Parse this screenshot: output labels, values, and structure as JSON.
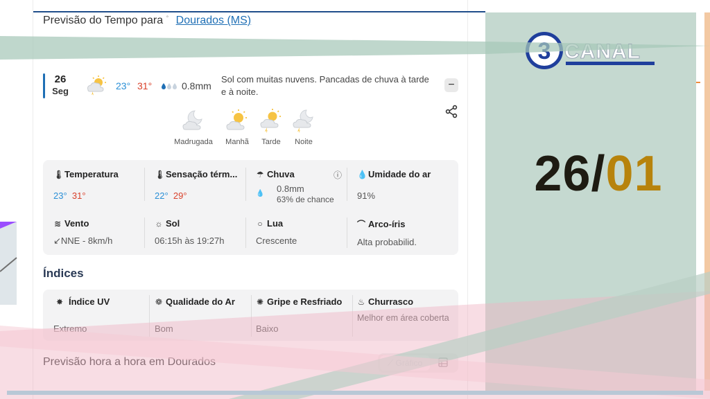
{
  "header": {
    "title": "Previsão do Tempo para",
    "superscript": "°",
    "city": "Dourados (MS)"
  },
  "day": {
    "number": "26",
    "weekday": "Seg",
    "temp_min": "23°",
    "temp_max": "31°",
    "rain": "0.8mm",
    "description": "Sol com muitas nuvens. Pancadas de chuva à tarde e à noite.",
    "collapse_label": "−",
    "icon": "partly-cloudy-rain-icon"
  },
  "periods": [
    {
      "label": "Madrugada",
      "icon": "moon-cloud-icon"
    },
    {
      "label": "Manhã",
      "icon": "sun-cloud-icon"
    },
    {
      "label": "Tarde",
      "icon": "sun-cloud-storm-icon"
    },
    {
      "label": "Noite",
      "icon": "moon-cloud-storm-icon"
    }
  ],
  "details": {
    "temperature": {
      "title": "Temperatura",
      "min": "23°",
      "max": "31°"
    },
    "feels_like": {
      "title": "Sensação térm...",
      "min": "22°",
      "max": "29°"
    },
    "rain": {
      "title": "Chuva",
      "amount": "0.8mm",
      "chance": "63% de chance"
    },
    "humidity": {
      "title": "Umidade do ar",
      "value": "91%"
    },
    "wind": {
      "title": "Vento",
      "value": "↙NNE - 8km/h"
    },
    "sun": {
      "title": "Sol",
      "value": "06:15h às 19:27h"
    },
    "moon": {
      "title": "Lua",
      "value": "Crescente"
    },
    "rainbow": {
      "title": "Arco-íris",
      "value": "Alta probabilid."
    }
  },
  "indices": {
    "title": "Índices",
    "items": [
      {
        "title": "Índice UV",
        "value": "Extremo"
      },
      {
        "title": "Qualidade do Ar",
        "value": "Bom"
      },
      {
        "title": "Gripe e Resfriado",
        "value": "Baixo"
      },
      {
        "title": "Churrasco",
        "value": "Melhor em área coberta"
      }
    ]
  },
  "hourly": {
    "title": "Previsão hora a hora em Dourados",
    "chart_toggle": "Gráfico"
  },
  "overlay": {
    "logo_number": "3",
    "logo_text": "CANAL",
    "date_day": "26/",
    "date_month": "01"
  },
  "colors": {
    "accent_blue": "#1f6fb5",
    "temp_min": "#2a8fd6",
    "temp_max": "#d9412b",
    "panel": "#c5d9d0",
    "date_dark": "#1e1b12",
    "date_gold": "#b7830c"
  }
}
